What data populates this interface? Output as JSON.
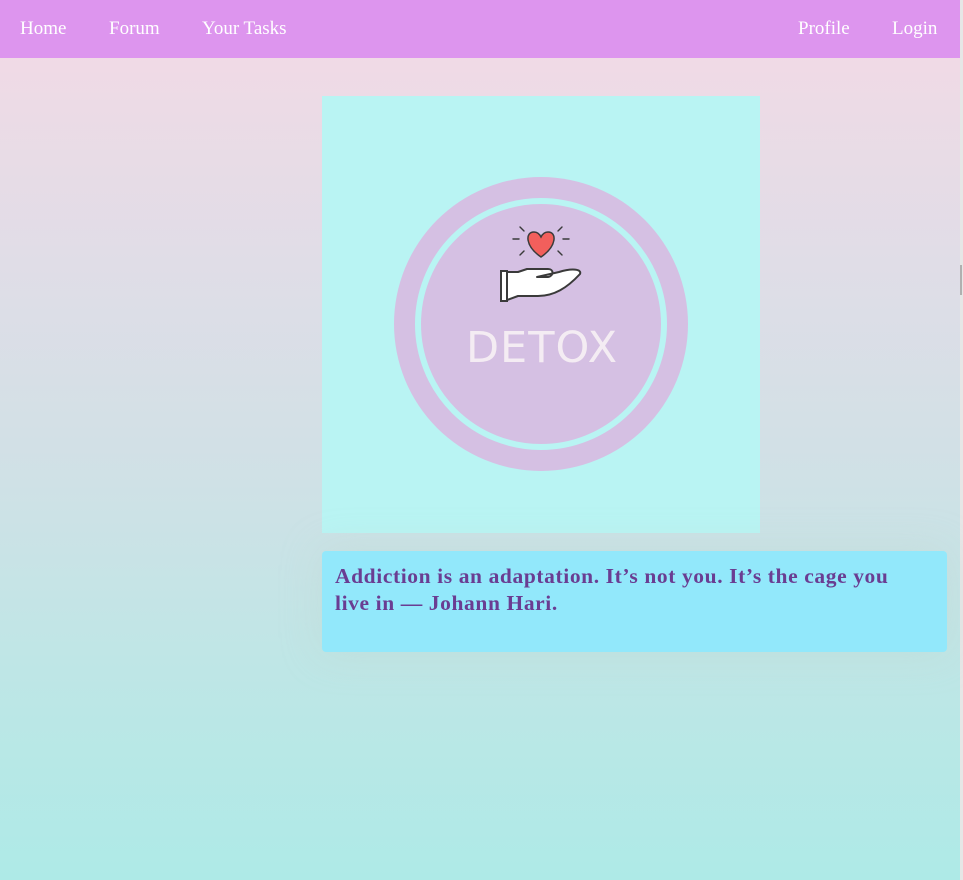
{
  "nav": {
    "home": "Home",
    "forum": "Forum",
    "tasks": "Your Tasks",
    "profile": "Profile",
    "login": "Login"
  },
  "logo": {
    "text": "DETOX",
    "icon": "heart-in-hand-icon"
  },
  "quote": {
    "text": "Addiction is an adaptation. It’s not you. It’s the cage you live in — Johann Hari."
  },
  "colors": {
    "navbar": "#dd95ee",
    "logo_background": "#b9f4f3",
    "logo_circle": "#d5c0e3",
    "heart": "#f25f5c",
    "quote_background": "#92e8fb",
    "quote_text": "#6a3d92"
  }
}
